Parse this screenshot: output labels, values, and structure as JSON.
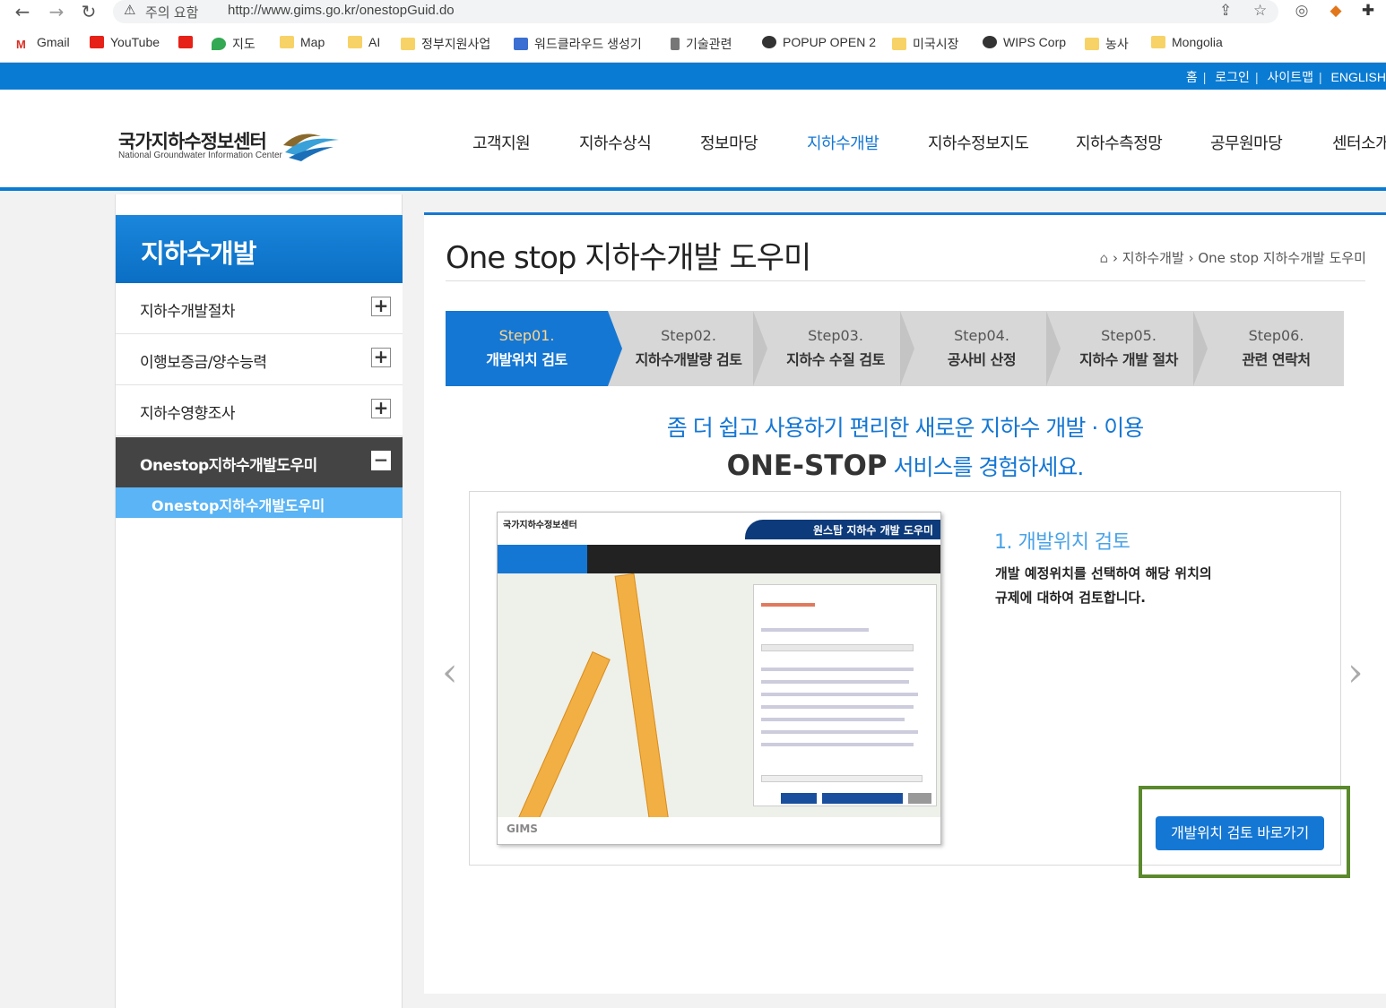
{
  "browser": {
    "security_label": "주의 요함",
    "url": "http://www.gims.go.kr/onestopGuid.do",
    "bookmarks": [
      {
        "label": "Gmail"
      },
      {
        "label": "YouTube"
      },
      {
        "label": "지도"
      },
      {
        "label": "Map"
      },
      {
        "label": "AI"
      },
      {
        "label": "정부지원사업"
      },
      {
        "label": "워드클라우드 생성기"
      },
      {
        "label": "기술관련"
      },
      {
        "label": "POPUP OPEN 2"
      },
      {
        "label": "미국시장"
      },
      {
        "label": "WIPS Corp"
      },
      {
        "label": "농사"
      },
      {
        "label": "Mongolia"
      }
    ]
  },
  "toplinks": [
    "홈",
    "로그인",
    "사이트맵",
    "ENGLISH"
  ],
  "logo": {
    "ko": "국가지하수정보센터",
    "en": "National Groundwater Information Center"
  },
  "gnb": [
    "고객지원",
    "지하수상식",
    "정보마당",
    "지하수개발",
    "지하수정보지도",
    "지하수측정망",
    "공무원마당",
    "센터소개"
  ],
  "sidebar": {
    "title": "지하수개발",
    "items": [
      {
        "label": "지하수개발절차",
        "toggle": "+"
      },
      {
        "label": "이행보증금/양수능력",
        "toggle": "+"
      },
      {
        "label": "지하수영향조사",
        "toggle": "+"
      },
      {
        "label": "Onestop지하수개발도우미",
        "toggle": "−"
      }
    ],
    "sub_item": "Onestop지하수개발도우미"
  },
  "page": {
    "title": "One stop 지하수개발 도우미",
    "breadcrumb": [
      "지하수개발",
      "One stop 지하수개발 도우미"
    ]
  },
  "steps": [
    {
      "num": "Step01.",
      "name": "개발위치 검토"
    },
    {
      "num": "Step02.",
      "name": "지하수개발량 검토"
    },
    {
      "num": "Step03.",
      "name": "지하수 수질 검토"
    },
    {
      "num": "Step04.",
      "name": "공사비 산정"
    },
    {
      "num": "Step05.",
      "name": "지하수 개발 절차"
    },
    {
      "num": "Step06.",
      "name": "관련 연락처"
    }
  ],
  "tagline": {
    "line1": "좀 더 쉽고 사용하기 편리한 새로운 지하수 개발 · 이용",
    "line2_bold": "ONE-STOP",
    "line2_rest": " 서비스를 경험하세요."
  },
  "slide": {
    "thumb_logo": "국가지하수정보센터",
    "thumb_banner": "원스탑 지하수 개발 도우미",
    "thumb_footer_logo": "GIMS",
    "heading": "1. 개발위치 검토",
    "desc1": "개발 예정위치를 선택하여 해당 위치의",
    "desc2": "규제에 대하여 검토합니다.",
    "button": "개발위치 검토 바로가기",
    "prev": "‹",
    "next": "›"
  },
  "colors": {
    "brand_blue": "#1577d4",
    "topbar_blue": "#0a7bd2",
    "highlight_green": "#5a8a2c"
  }
}
